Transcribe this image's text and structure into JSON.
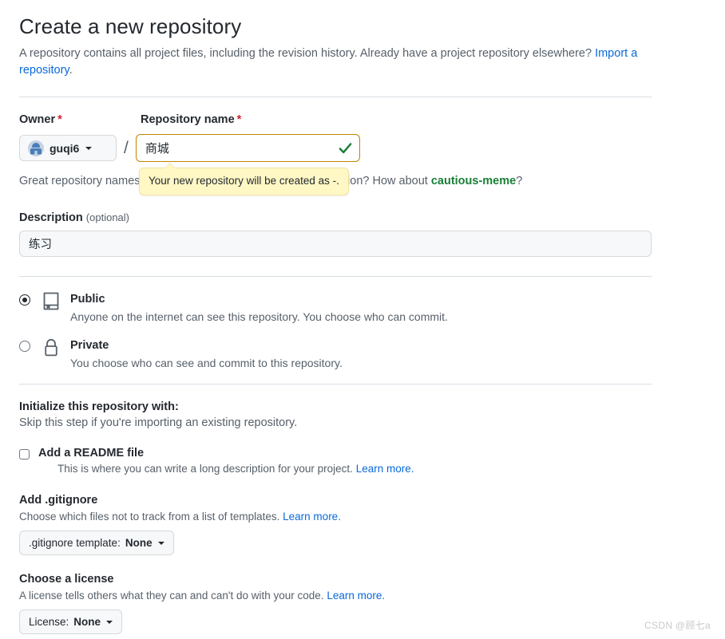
{
  "header": {
    "title": "Create a new repository",
    "subtitle_before": "A repository contains all project files, including the revision history. Already have a project repository elsewhere?",
    "import_link": "Import a repository",
    "subtitle_after": "."
  },
  "owner": {
    "label": "Owner",
    "required_mark": "*",
    "name": "guqi6",
    "separator": "/"
  },
  "repo_name": {
    "label": "Repository name",
    "required_mark": "*",
    "value": "商城",
    "placeholder": "",
    "valid_icon": "check-icon",
    "border_color": "#bf8700",
    "check_color": "#1a7f37"
  },
  "helper": {
    "text_before": "Great repository names are short and memorable. Need inspiration? How about ",
    "suggestion": "cautious-meme",
    "text_after": "?",
    "suggestion_color": "#1a7f37"
  },
  "tooltip": {
    "text": "Your new repository will be created as -.",
    "background": "#fff8c5",
    "border": "#f0e2a6"
  },
  "description": {
    "label": "Description",
    "optional": "(optional)",
    "value": "练习",
    "placeholder": ""
  },
  "visibility": {
    "options": [
      {
        "id": "public",
        "title": "Public",
        "description": "Anyone on the internet can see this repository. You choose who can commit.",
        "icon": "repo-book-icon",
        "selected": true
      },
      {
        "id": "private",
        "title": "Private",
        "description": "You choose who can see and commit to this repository.",
        "icon": "lock-icon",
        "selected": false
      }
    ]
  },
  "initialize": {
    "title": "Initialize this repository with:",
    "subtitle": "Skip this step if you're importing an existing repository.",
    "readme": {
      "label": "Add a README file",
      "help": "This is where you can write a long description for your project.",
      "learn_more": "Learn more.",
      "checked": false
    }
  },
  "gitignore": {
    "title": "Add .gitignore",
    "subtitle": "Choose which files not to track from a list of templates.",
    "learn_more": "Learn more.",
    "button_prefix": ".gitignore template: ",
    "button_value": "None"
  },
  "license": {
    "title": "Choose a license",
    "subtitle": "A license tells others what they can and can't do with your code.",
    "learn_more": "Learn more.",
    "button_prefix": "License: ",
    "button_value": "None"
  },
  "watermark": {
    "text": "CSDN @顾七a"
  },
  "colors": {
    "link": "#0969da",
    "required": "#cf222e",
    "muted": "#57606a",
    "text": "#24292f",
    "border": "#d8dee4"
  }
}
